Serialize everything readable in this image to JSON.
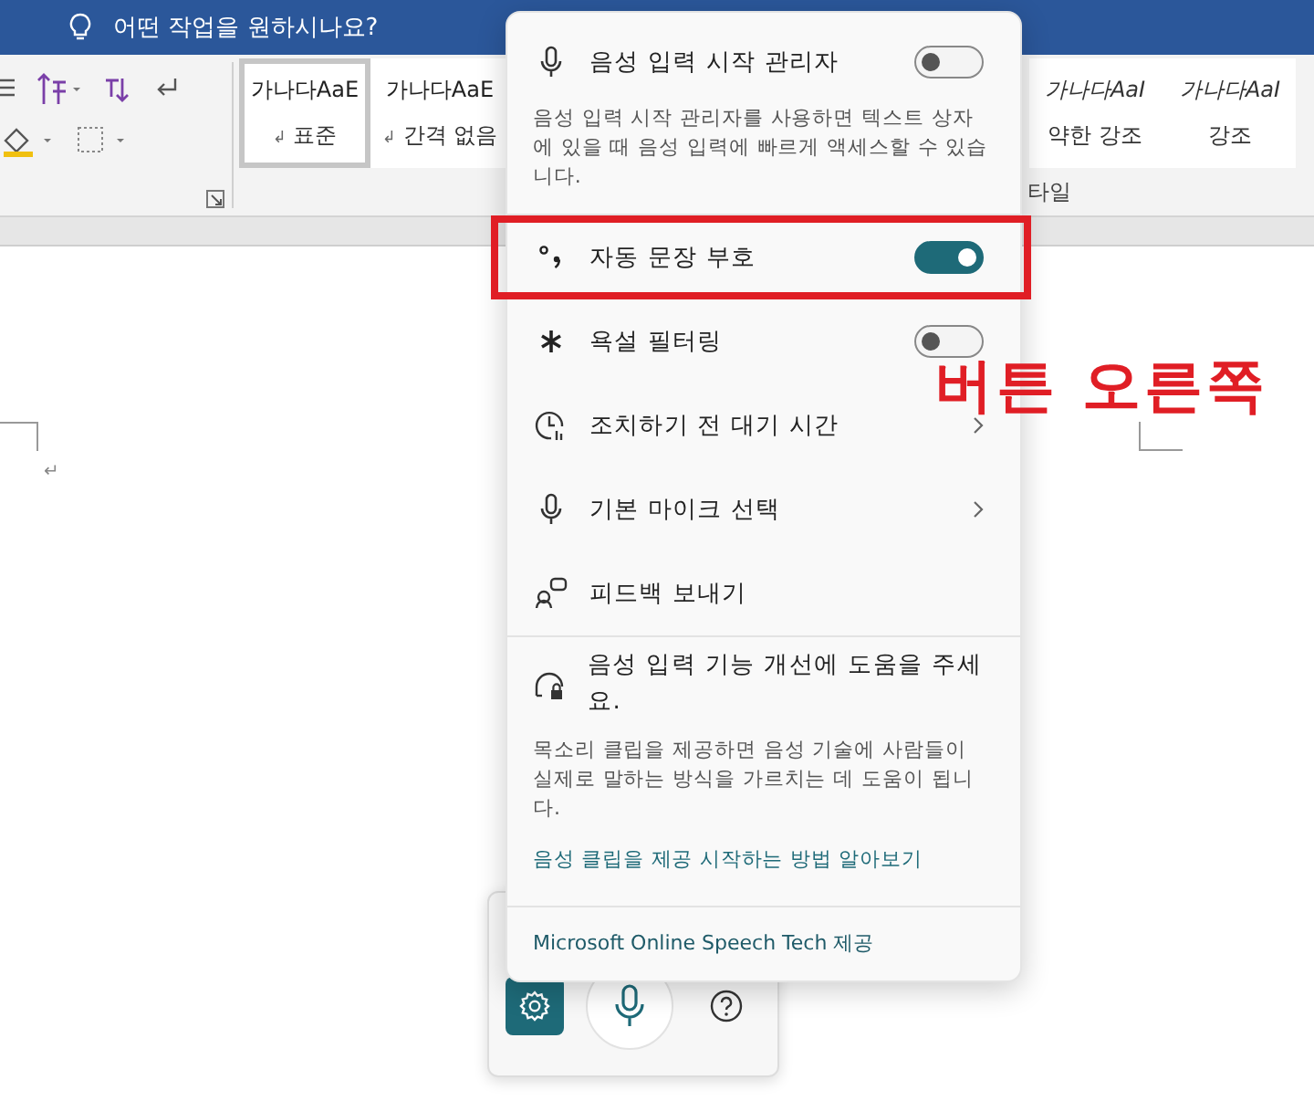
{
  "title_bar": {
    "tell_me": "어떤 작업을 원하시나요?"
  },
  "ribbon": {
    "styles_left": [
      {
        "preview": "가나다AaE",
        "mark": "↲",
        "name": "표준",
        "italic": false,
        "selected": true
      },
      {
        "preview": "가나다AaE",
        "mark": "↲",
        "name": "간격 없음",
        "italic": false,
        "selected": false
      }
    ],
    "styles_right": [
      {
        "preview": "가나다AaI",
        "name": "약한 강조",
        "italic": true,
        "selected": false
      },
      {
        "preview": "가나다AaI",
        "name": "강조",
        "italic": true,
        "selected": false
      }
    ],
    "group_label": "타일"
  },
  "document": {
    "paragraph_mark": "↵"
  },
  "popup": {
    "items": [
      {
        "kind": "toggle",
        "label": "음성 입력 시작 관리자",
        "on": false,
        "highlighted": false,
        "description": "음성 입력 시작 관리자를 사용하면 텍스트 상자에 있을 때 음성 입력에 빠르게 액세스할 수 있습니다."
      },
      {
        "kind": "toggle",
        "label": "자동 문장 부호",
        "on": true,
        "highlighted": true
      },
      {
        "kind": "toggle",
        "label": "욕설 필터링",
        "on": false,
        "highlighted": false
      },
      {
        "kind": "submenu",
        "label": "조치하기 전 대기 시간",
        "highlighted": false
      },
      {
        "kind": "submenu",
        "label": "기본 마이크 선택",
        "highlighted": false
      },
      {
        "kind": "action",
        "label": "피드백 보내기",
        "highlighted": false
      }
    ],
    "help": {
      "title": "음성 입력 기능 개선에 도움을 주세요.",
      "description": "목소리 클립을 제공하면 음성 기술에 사람들이 실제로 말하는 방식을 가르치는 데 도움이 됩니다.",
      "link": "음성 클립을 제공 시작하는 방법 알아보기"
    },
    "footer": "Microsoft Online Speech Tech 제공"
  },
  "annotation": {
    "text": "버튼 오른쪽"
  },
  "voice_bar": {
    "settings_selected": true
  }
}
